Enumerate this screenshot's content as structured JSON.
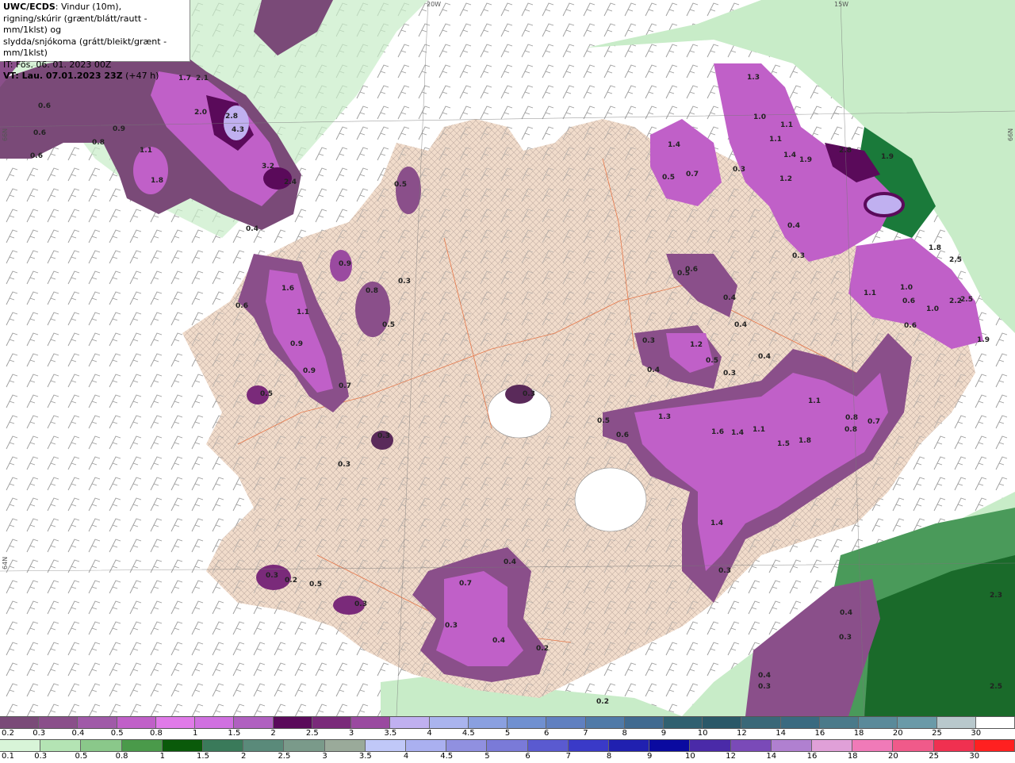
{
  "info": {
    "model": "UWC/ECDS",
    "desc1": ": Vindur (10m),",
    "desc2": "rigning/skúrir (grænt/blátt/rautt - mm/1klst) og",
    "desc3": "slydda/snjókoma (grátt/bleikt/grænt - mm/1klst)",
    "init": "IT: Fös. 06. 01. 2023 00Z",
    "valid_label": "VT: Lau. 07.01.2023 23Z",
    "valid_offset": " (+47 h)"
  },
  "map_labels": {
    "coord_20w": "20W",
    "coord_15w": "15W",
    "coord_66n_left": "66N",
    "coord_66n_right": "66N",
    "coord_64n_left": "64N",
    "values": [
      "1.7",
      "2.1",
      "2.0",
      "2.8",
      "4.3",
      "3.2",
      "2.4",
      "1.8",
      "0.9",
      "1.1",
      "0.6",
      "0.6",
      "0.6",
      "0.8",
      "0.4",
      "1.6",
      "1.1",
      "0.9",
      "0.9",
      "0.7",
      "0.5",
      "0.6",
      "0.9",
      "0.8",
      "0.5",
      "0.3",
      "0.5",
      "0.3",
      "0.3",
      "0.3",
      "1.3",
      "1.0",
      "1.1",
      "1.1",
      "1.4",
      "1.9",
      "2.8",
      "1.9",
      "1.2",
      "0.4",
      "0.3",
      "0.5",
      "0.7",
      "1.4",
      "0.3",
      "0.5",
      "0.6",
      "0.4",
      "0.4",
      "1.2",
      "0.3",
      "0.5",
      "0.4",
      "0.3",
      "0.4",
      "1.0",
      "1.1",
      "0.6",
      "1.8",
      "2.5",
      "2.2",
      "2.5",
      "1.0",
      "1.9",
      "0.6",
      "1.6",
      "1.4",
      "1.1",
      "1.5",
      "1.8",
      "0.8",
      "1.1",
      "0.7",
      "0.8",
      "1.3",
      "0.6",
      "0.5",
      "0.4",
      "0.7",
      "0.4",
      "0.2",
      "0.3",
      "0.3",
      "0.2",
      "0.3",
      "0.5",
      "1.4",
      "0.3",
      "0.3",
      "0.4",
      "0.4",
      "0.3",
      "2.5",
      "2.3",
      "0.2"
    ]
  },
  "legend_snow": {
    "ticks": [
      "0.2",
      "0.3",
      "0.4",
      "0.5",
      "0.8",
      "1",
      "1.5",
      "2",
      "2.5",
      "3",
      "3.5",
      "4",
      "4.5",
      "5",
      "6",
      "7",
      "8",
      "9",
      "10",
      "12",
      "14",
      "16",
      "18",
      "20",
      "25",
      "30"
    ],
    "colors": [
      "#7a4a78",
      "#8a4f8a",
      "#a05aa8",
      "#c060c8",
      "#e07ae8",
      "#d070e0",
      "#b060c0",
      "#5a0a5a",
      "#7a2a7a",
      "#9a4aa0",
      "#c0b0f0",
      "#aab4ee",
      "#8aa0e0",
      "#7090d0",
      "#6080c0",
      "#507aa8",
      "#406a90",
      "#306070",
      "#2a5868",
      "#3a6878",
      "#3a6a80",
      "#4a7a8a",
      "#5a8a9a",
      "#6a9aa8",
      "#b8c8cc",
      "#ffffff"
    ]
  },
  "legend_rain": {
    "ticks": [
      "0.1",
      "0.3",
      "0.5",
      "0.8",
      "1",
      "1.5",
      "2",
      "2.5",
      "3",
      "3.5",
      "4",
      "4.5",
      "5",
      "6",
      "7",
      "8",
      "9",
      "10",
      "12",
      "14",
      "16",
      "18",
      "20",
      "25",
      "30"
    ],
    "colors": [
      "#d8f4d8",
      "#b4e4b4",
      "#8ac88a",
      "#4a9a4a",
      "#0a5a0a",
      "#3a7a5a",
      "#5a8a7a",
      "#7a9a8a",
      "#9aaa9a",
      "#c0c8f8",
      "#aab0f0",
      "#9090e0",
      "#7a7ad8",
      "#5a5ad0",
      "#3a3ac8",
      "#2020b0",
      "#0a0aa0",
      "#4a2aa8",
      "#7a4ab8",
      "#b080d0",
      "#e0a0d8",
      "#f07ab8",
      "#f05a8a",
      "#f03050",
      "#ff2020"
    ]
  }
}
